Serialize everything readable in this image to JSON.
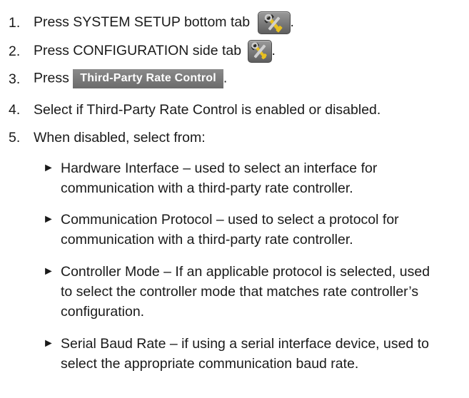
{
  "steps": [
    {
      "number": "1.",
      "text_before": "Press SYSTEM SETUP bottom tab",
      "text_after": ".",
      "icon": "wrench-hammer-icon"
    },
    {
      "number": "2.",
      "text_before": "Press CONFIGURATION side tab",
      "text_after": ".",
      "icon": "wrench-hammer-icon"
    },
    {
      "number": "3.",
      "text_before": "Press",
      "button_label": "Third-Party Rate Control",
      "text_after": "."
    },
    {
      "number": "4.",
      "text": "Select if Third-Party Rate Control is enabled or disabled."
    },
    {
      "number": "5.",
      "text": "When disabled, select from:"
    }
  ],
  "sub_items": [
    {
      "arrow": "►",
      "lines": [
        "Hardware Interface – used to select an interface for",
        "communication with a third-party rate controller."
      ]
    },
    {
      "arrow": "►",
      "lines": [
        "Communication Protocol – used to select a protocol for",
        "communication with a third-party rate controller."
      ]
    },
    {
      "arrow": "►",
      "lines": [
        "Controller Mode – If an applicable protocol is selected, used",
        "to select the controller mode that matches rate controller’s",
        "configuration."
      ]
    },
    {
      "arrow": "►",
      "lines": [
        "Serial Baud Rate – if using a serial interface device, used to",
        "select the appropriate communication baud rate."
      ]
    }
  ]
}
